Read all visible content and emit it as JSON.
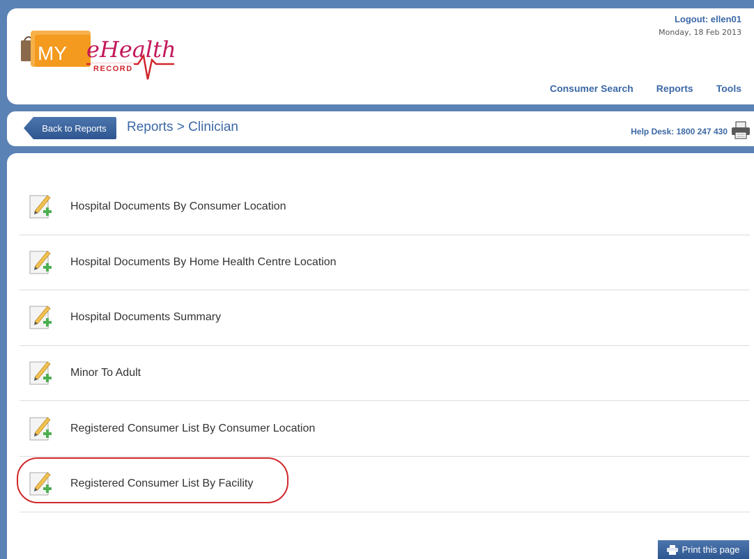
{
  "header": {
    "logo": {
      "my": "MY",
      "ehealth": "eHealth",
      "record": "RECORD"
    },
    "logout": "Logout: ellen01",
    "date": "Monday, 18 Feb 2013",
    "nav": [
      {
        "label": "Consumer Search"
      },
      {
        "label": "Reports"
      },
      {
        "label": "Tools"
      }
    ]
  },
  "toolbar": {
    "back_label": "Back to Reports",
    "breadcrumb": "Reports > Clinician",
    "helpdesk": "Help Desk: 1800 247 430"
  },
  "reports": [
    {
      "label": "Hospital Documents By Consumer Location"
    },
    {
      "label": "Hospital Documents By Home Health Centre Location"
    },
    {
      "label": "Hospital Documents Summary"
    },
    {
      "label": "Minor To Adult"
    },
    {
      "label": "Registered Consumer List By Consumer Location"
    },
    {
      "label": "Registered Consumer List By Facility"
    }
  ],
  "footer": {
    "print_label": "Print this page"
  },
  "colors": {
    "brand_blue": "#3b68a6",
    "frame_blue": "#5b82b5",
    "logo_orange": "#f39a1f",
    "logo_red": "#d0262b",
    "highlight": "#d0262b"
  },
  "icons": [
    "edit-document-icon",
    "printer-icon"
  ]
}
